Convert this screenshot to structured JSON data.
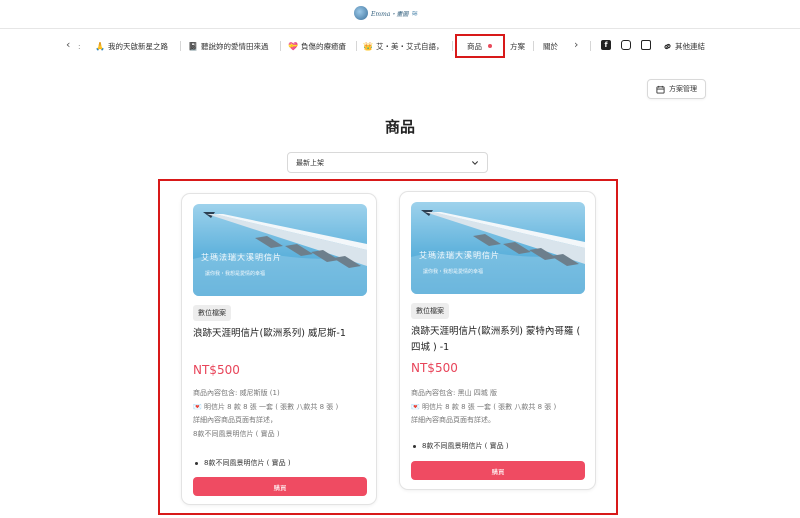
{
  "header": {
    "logo_text": "Emma・畫圖",
    "logo_deco": "≋"
  },
  "nav": {
    "prev": "‹",
    "next": "›",
    "colon": ":",
    "items": [
      {
        "emoji": "🙏",
        "label": "我的天啟新星之路"
      },
      {
        "emoji": "📓",
        "label": "聽說妳的愛情田來過"
      },
      {
        "emoji": "💝",
        "label": "負傷的療癒瘡"
      },
      {
        "emoji": "👑",
        "label": "艾・美・艾式自語，"
      },
      {
        "label": "商品"
      },
      {
        "label": "方案"
      },
      {
        "label": "關於"
      },
      {
        "label": "其他連結"
      }
    ]
  },
  "plan_button": {
    "label": "方案管理"
  },
  "page_title": "商品",
  "sort": {
    "selected": "最新上架"
  },
  "products": [
    {
      "image_title": "艾瑪法瑞大溪明信片",
      "image_sub": "讓你我・我想是愛情的幸福",
      "badge": "數位檔案",
      "name": "浪跡天涯明信片(歐洲系列) 威尼斯-1",
      "price": "NT$500",
      "desc": [
        "商品內容包含: 威尼斯版 (1)",
        "💌 明信片 8 款 8 張 一套 ( 張數 八款共 8 張 )",
        "詳細內容商品頁面有詳述，",
        "8款不同風景明信片 ( 實品 )"
      ],
      "bullet": "8款不同風景明信片 ( 實品 )",
      "buy": "購買"
    },
    {
      "image_title": "艾瑪法瑞大溪明信片",
      "image_sub": "讓你我・我想是愛情的幸福",
      "badge": "數位檔案",
      "name": "浪跡天涯明信片(歐洲系列) 蒙特內哥羅 ( 四城 ) -1",
      "price": "NT$500",
      "desc": [
        "商品內容包含: 黑山 四城 版",
        "💌 明信片 8 款 8 張 一套 ( 張數 八款共 8 張 )",
        "詳細內容商品頁面有詳述。"
      ],
      "bullet": "8款不同風景明信片 ( 實品 )",
      "buy": "購買"
    }
  ]
}
